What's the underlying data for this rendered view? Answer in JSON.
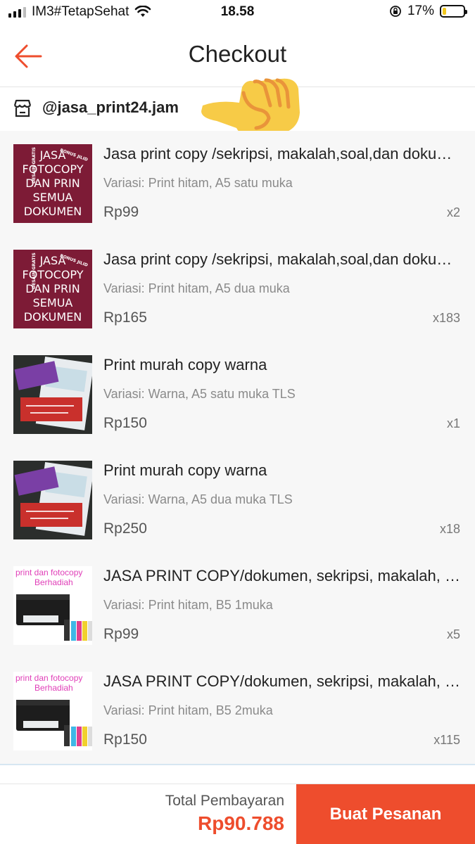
{
  "status_bar": {
    "carrier": "IM3#TetapSehat",
    "time": "18.58",
    "battery": "17%",
    "battery_level": 0.17,
    "icons": [
      "signal-icon",
      "wifi-icon",
      "orientation-lock-icon",
      "battery-icon"
    ]
  },
  "header": {
    "title": "Checkout",
    "back_icon": "arrow-left-icon",
    "accent": "#ee4d2d"
  },
  "shop": {
    "name": "@jasa_print24.jam",
    "icon": "store-icon"
  },
  "items": [
    {
      "name": "Jasa print copy /sekripsi, makalah,soal,dan dokumen",
      "variant": "Variasi: Print hitam, A5 satu muka",
      "price": "Rp99",
      "qty": "x2",
      "thumb": {
        "type": "maroon",
        "lines": [
          "JASA",
          "FOTOCOPY",
          "DAN PRIN",
          "SEMUA",
          "DOKUMEN"
        ]
      }
    },
    {
      "name": "Jasa print copy /sekripsi, makalah,soal,dan dokumen",
      "variant": "Variasi: Print hitam, A5 dua muka",
      "price": "Rp165",
      "qty": "x183",
      "thumb": {
        "type": "maroon",
        "lines": [
          "JASA",
          "FOTOCOPY",
          "DAN PRIN",
          "SEMUA",
          "DOKUMEN"
        ]
      }
    },
    {
      "name": "Print murah copy warna",
      "variant": "Variasi: Warna, A5 satu muka TLS",
      "price": "Rp150",
      "qty": "x1",
      "thumb": {
        "type": "photo"
      }
    },
    {
      "name": "Print murah copy warna",
      "variant": "Variasi: Warna, A5 dua muka TLS",
      "price": "Rp250",
      "qty": "x18",
      "thumb": {
        "type": "photo"
      }
    },
    {
      "name": "JASA PRINT COPY/dokumen, sekripsi, makalah, soal",
      "variant": "Variasi: Print hitam, B5 1muka",
      "price": "Rp99",
      "qty": "x5",
      "thumb": {
        "type": "printer",
        "caption": "print dan fotocopy",
        "caption2": "Berhadiah"
      }
    },
    {
      "name": "JASA PRINT COPY/dokumen, sekripsi, makalah, soal",
      "variant": "Variasi: Print hitam, B5 2muka",
      "price": "Rp150",
      "qty": "x115",
      "thumb": {
        "type": "printer",
        "caption": "print dan fotocopy",
        "caption2": "Berhadiah"
      }
    }
  ],
  "footer": {
    "total_label": "Total Pembayaran",
    "total_value": "Rp90.788",
    "order_button": "Buat Pesanan"
  },
  "colors": {
    "accent": "#ee4d2d",
    "list_background": "#f7f7f7",
    "maroon_thumb": "#7d1b36"
  }
}
